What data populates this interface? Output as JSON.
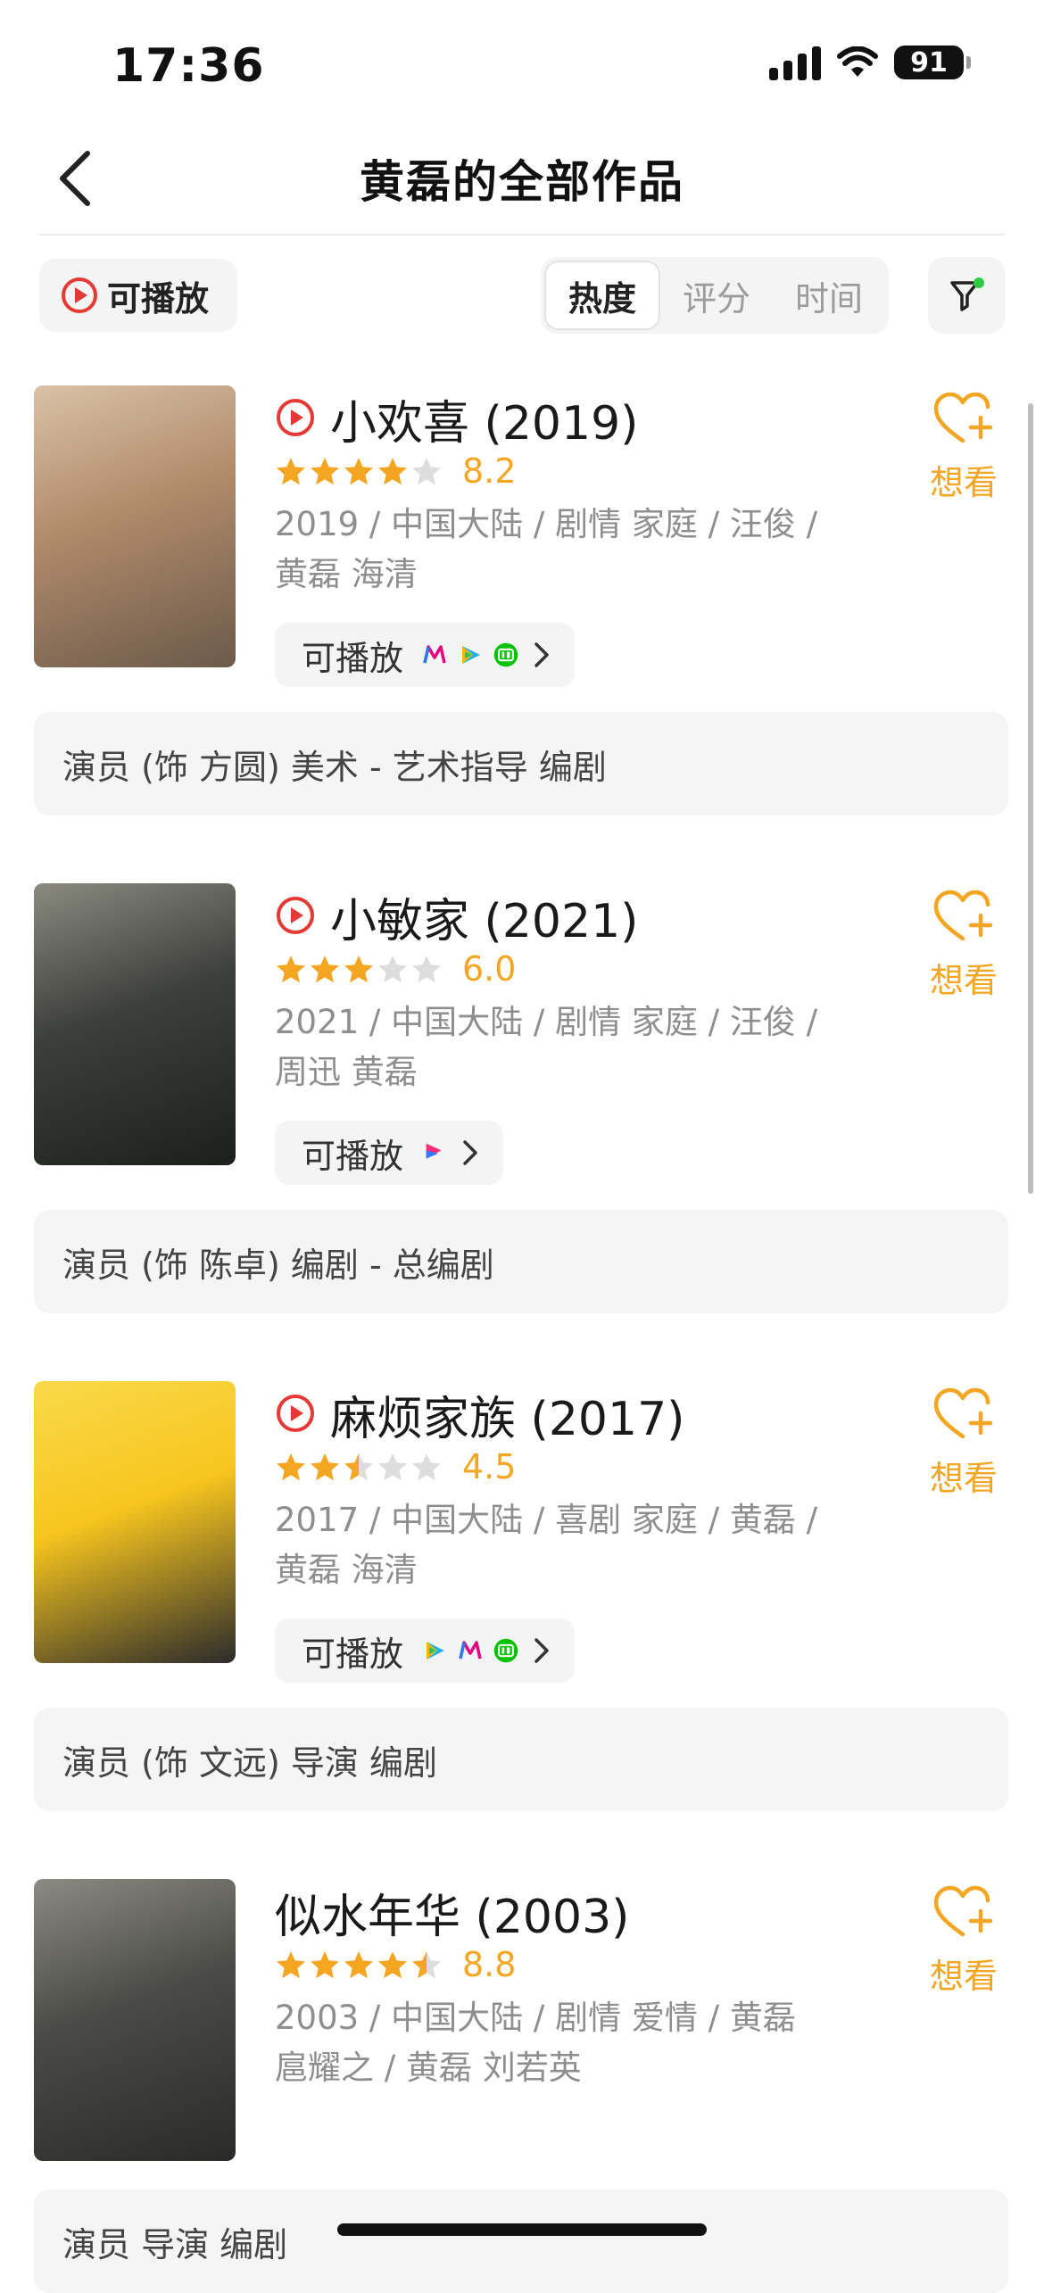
{
  "status": {
    "time": "17:36",
    "battery": "91"
  },
  "header": {
    "title": "黄磊的全部作品"
  },
  "filters": {
    "playable": "可播放",
    "sort_tabs": [
      {
        "label": "热度",
        "active": true
      },
      {
        "label": "评分",
        "active": false
      },
      {
        "label": "时间",
        "active": false
      }
    ]
  },
  "films": [
    {
      "title": "小欢喜 (2019)",
      "has_play_icon": true,
      "stars": 4,
      "rating": "8.2",
      "meta_line1": "2019 / 中国大陆 / 剧情 家庭 / 汪俊 /",
      "meta_line2": "黄磊 海清",
      "play_label": "可播放",
      "platforms": [
        "mgtv-icon",
        "tencent-video-icon",
        "iqiyi-icon"
      ],
      "want_label": "想看",
      "role": "演员 (饰 方圆) 美术 - 艺术指导 编剧",
      "poster_colors": [
        "#b08a6a",
        "#d9c2a6",
        "#6b5a4a"
      ]
    },
    {
      "title": "小敏家 (2021)",
      "has_play_icon": true,
      "stars": 3,
      "rating": "6.0",
      "meta_line1": "2021 / 中国大陆 / 剧情 家庭 / 汪俊 /",
      "meta_line2": "周迅 黄磊",
      "play_label": "可播放",
      "platforms": [
        "youku-icon"
      ],
      "want_label": "想看",
      "role": "演员 (饰 陈卓) 编剧 - 总编剧",
      "poster_colors": [
        "#3d3f3b",
        "#8a8a80",
        "#1d1f1c"
      ]
    },
    {
      "title": "麻烦家族 (2017)",
      "has_play_icon": true,
      "stars": 2.5,
      "rating": "4.5",
      "meta_line1": "2017 / 中国大陆 / 喜剧 家庭 / 黄磊 /",
      "meta_line2": "黄磊 海清",
      "play_label": "可播放",
      "platforms": [
        "tencent-video-icon",
        "mgtv-icon",
        "iqiyi-icon"
      ],
      "want_label": "想看",
      "role": "演员 (饰 文远) 导演 编剧",
      "poster_colors": [
        "#f7c51e",
        "#f9d94a",
        "#2b2b2b"
      ]
    },
    {
      "title": "似水年华 (2003)",
      "has_play_icon": false,
      "stars": 4.5,
      "rating": "8.8",
      "meta_line1": "2003 / 中国大陆 / 剧情 爱情 / 黄磊",
      "meta_line2": "扈耀之 / 黄磊 刘若英",
      "play_label": "",
      "platforms": [],
      "want_label": "想看",
      "role": "演员 导演 编剧",
      "poster_colors": [
        "#4a4a46",
        "#8c8a82",
        "#2a2a28"
      ]
    }
  ]
}
